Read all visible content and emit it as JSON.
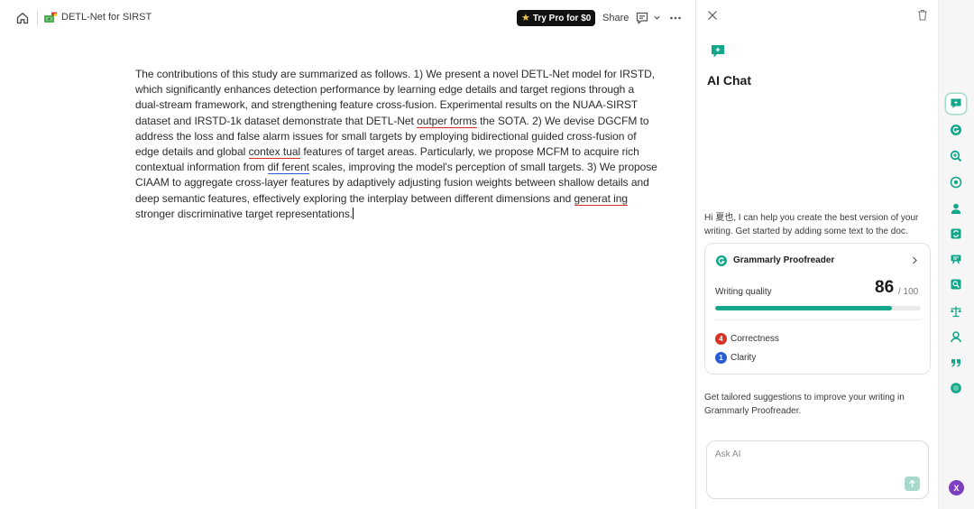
{
  "topbar": {
    "doc_title": "DETL-Net for SIRST",
    "try_pro_label": "Try Pro for $0",
    "share_label": "Share"
  },
  "document": {
    "s1": "The contributions of this study are summarized as follows. 1) We present a novel DETL-Net model for IRSTD, which significantly enhances detection performance by learning edge details and target regions through a dual-stream framework, and strengthening feature cross-fusion. Experimental results on the NUAA-SIRST dataset and IRSTD-1k dataset demonstrate that DETL-Net ",
    "e1": "outper forms",
    "s2": " the SOTA. 2) We devise DGCFM to address the loss and false alarm issues for small targets by employing bidirectional guided cross-fusion of edge details and global ",
    "e2": "contex tual",
    "s3": " features of target areas. Particularly, we propose MCFM to acquire rich contextual information from ",
    "e3": "dif ferent",
    "s4": " scales, improving the model's perception of small targets. 3) We propose CIAAM to aggregate cross-layer features by adaptively adjusting fusion weights between shallow details and deep semantic features, effectively exploring the interplay between different dimensions and ",
    "e4": "generat ing",
    "s5": " stronger discriminative target representations."
  },
  "panel": {
    "title": "AI Chat",
    "greeting": "Hi 夏也, I can help you create the best version of your writing. Get started by adding some text to the doc.",
    "card": {
      "title": "Grammarly Proofreader",
      "writing_quality_label": "Writing quality",
      "score": "86",
      "score_max": "/ 100",
      "score_fraction": 0.86,
      "metrics": [
        {
          "count": "4",
          "label": "Correctness",
          "color": "#d93025"
        },
        {
          "count": "1",
          "label": "Clarity",
          "color": "#2a5bd7"
        }
      ]
    },
    "tailored_text": "Get tailored suggestions to improve your writing in Grammarly Proofreader.",
    "ask_placeholder": "Ask AI"
  },
  "rail": {
    "items": [
      "ai-chat-icon",
      "grammarly-icon",
      "search-plus-icon",
      "humanizer-icon",
      "user-icon",
      "paraphrase-icon",
      "reader-icon",
      "ai-detector-icon",
      "scales-icon",
      "expert-icon",
      "quote-icon",
      "circle-icon"
    ],
    "avatar_initial": "X"
  },
  "colors": {
    "accent": "#12a68a",
    "error_red": "#d93025",
    "clarity_blue": "#2a5bd7"
  }
}
